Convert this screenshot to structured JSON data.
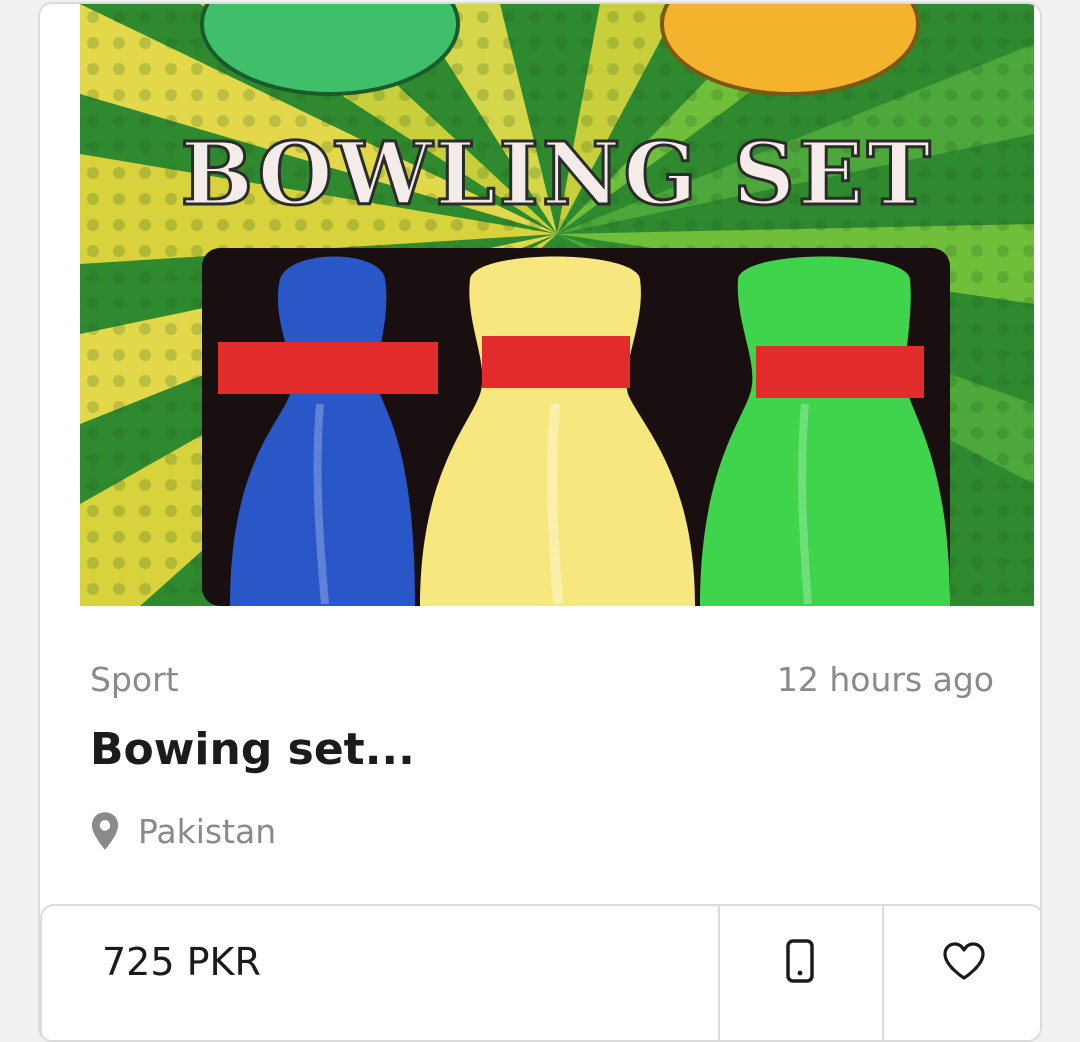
{
  "listing": {
    "image_text": "BOWLING SET",
    "category": "Sport",
    "posted": "12 hours ago",
    "title": "Bowing set...",
    "location": "Pakistan",
    "price": "725 PKR"
  },
  "icons": {
    "location": "map-pin-icon",
    "contact": "phone-icon",
    "favorite": "heart-icon"
  },
  "colors": {
    "text_primary": "#1b1b1d",
    "text_secondary": "#8a8a8d",
    "border": "#dcdcdf",
    "pin_blue": "#2a57c8",
    "pin_yellow": "#f6e87f",
    "pin_green": "#3fd44c",
    "band_red": "#e22b2b"
  }
}
